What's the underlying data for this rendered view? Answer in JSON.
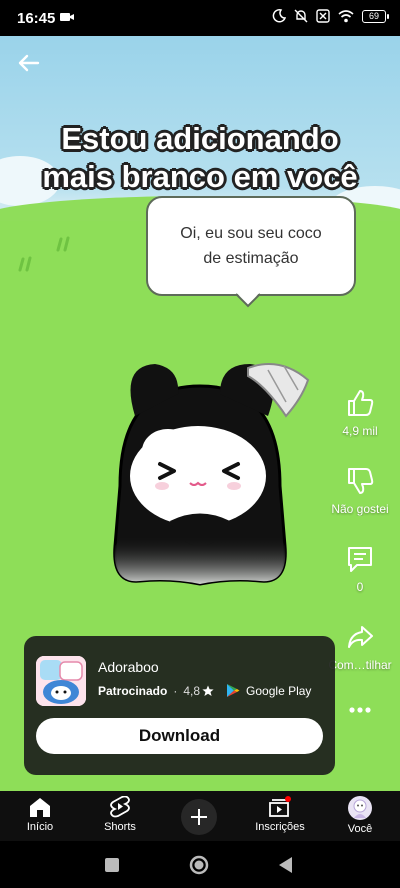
{
  "status_bar": {
    "time": "16:45",
    "battery": "69"
  },
  "video": {
    "caption_line1": "Estou adicionando",
    "caption_line2": "mais branco em você",
    "speech_line1": "Oi, eu sou seu coco",
    "speech_line2": "de estimação"
  },
  "rail": {
    "likes": "4,9 mil",
    "dislike_label": "Não gostei",
    "comments": "0",
    "share_label": "Com…tilhar"
  },
  "ad": {
    "app_name": "Adoraboo",
    "sponsored": "Patrocinado",
    "separator": "·",
    "rating": "4,8",
    "store": "Google Play",
    "download_label": "Download"
  },
  "nav": {
    "home": "Início",
    "shorts": "Shorts",
    "subscriptions": "Inscrições",
    "you": "Você"
  },
  "icons": [
    "back-arrow-icon",
    "like-icon",
    "dislike-icon",
    "comment-icon",
    "share-icon",
    "more-icon",
    "home-icon",
    "shorts-icon",
    "add-icon",
    "subscriptions-icon",
    "avatar"
  ],
  "colors": {
    "accent": "#ff0000",
    "grass": "#8ede58",
    "sky": "#a8dbee"
  }
}
